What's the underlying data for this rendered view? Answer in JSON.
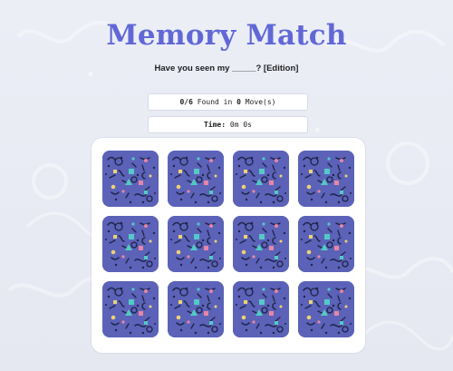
{
  "header": {
    "title": "Memory Match",
    "subtitle": "Have you seen my _____? [Edition]"
  },
  "stats": {
    "found_prefix": "0/6",
    "found_mid": "Found in",
    "moves_value": "0",
    "moves_suffix": "Move(s)",
    "time_label": "Time:",
    "time_value": "0m 0s"
  },
  "board": {
    "rows": 3,
    "cols": 4,
    "card_back_color": "#5b62b8",
    "cards": [
      {
        "state": "face-down"
      },
      {
        "state": "face-down"
      },
      {
        "state": "face-down"
      },
      {
        "state": "face-down"
      },
      {
        "state": "face-down"
      },
      {
        "state": "face-down"
      },
      {
        "state": "face-down"
      },
      {
        "state": "face-down"
      },
      {
        "state": "face-down"
      },
      {
        "state": "face-down"
      },
      {
        "state": "face-down"
      },
      {
        "state": "face-down"
      }
    ]
  },
  "colors": {
    "title": "#6168d6",
    "background": "#e7e9f2",
    "panel": "#ffffff",
    "card_back": "#5b62b8",
    "accent_teal": "#54d0c8",
    "accent_pink": "#f08aa3",
    "accent_yellow": "#f5d86f"
  }
}
